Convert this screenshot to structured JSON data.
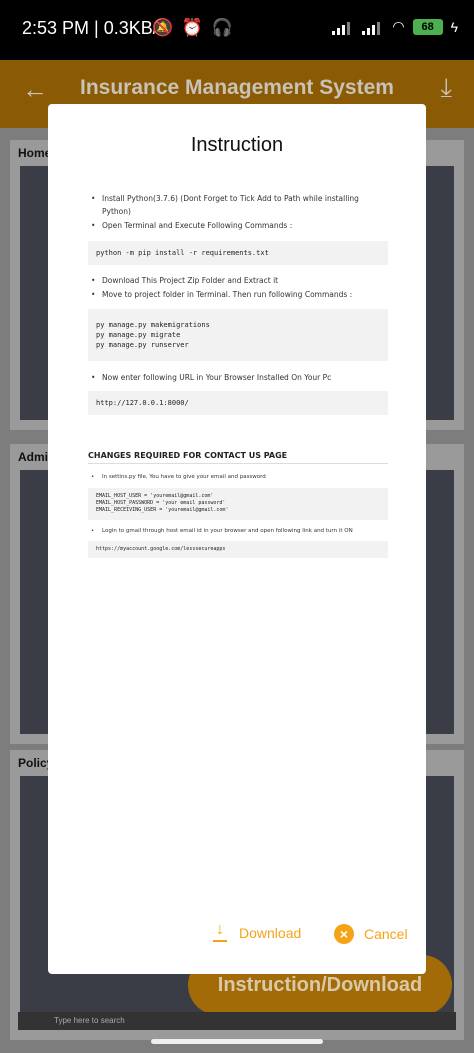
{
  "status_bar": {
    "time": "2:53 PM | 0.3KB/s",
    "notification_icons": "🔕 ⏰ 🎧",
    "battery": "68"
  },
  "app_bar": {
    "back_icon": "arrow-left-icon",
    "title": "Insurance Management System",
    "download_icon": "download-icon"
  },
  "background": {
    "cards": [
      {
        "label": "Home"
      },
      {
        "label": "Admi"
      },
      {
        "label": "Policy"
      }
    ],
    "fab_label": "Instruction/Download",
    "taskbar_search": "Type here to search"
  },
  "dialog": {
    "title": "Instruction",
    "steps_1": [
      "Install Python(3.7.6) (Dont Forget to Tick Add to Path while installing Python)",
      "Open Terminal and Execute Following Commands :"
    ],
    "code_1": "python -m pip install -r requirements.txt",
    "steps_2": [
      "Download This Project Zip Folder and Extract it",
      "Move to project folder in Terminal. Then run following Commands :"
    ],
    "code_2": "py manage.py makemigrations\npy manage.py migrate\npy manage.py runserver",
    "steps_3": [
      "Now enter following URL in Your Browser Installed On Your Pc"
    ],
    "code_3": "http://127.0.0.1:8000/",
    "section_title": "CHANGES REQUIRED FOR CONTACT US PAGE",
    "steps_4": [
      "In settins.py file, You have to give your email and password"
    ],
    "code_4": "EMAIL_HOST_USER = 'youremail@gmail.com'\nEMAIL_HOST_PASSWORD = 'your email password'\nEMAIL_RECEIVING_USER = 'youremail@gmail.com'",
    "steps_5": [
      "Login to gmail through host email id in your browser and open following link and turn it ON"
    ],
    "code_5": "https://myaccount.google.com/lesssecureapps",
    "download_label": "Download",
    "cancel_label": "Cancel",
    "accent_color": "#f5a316"
  }
}
